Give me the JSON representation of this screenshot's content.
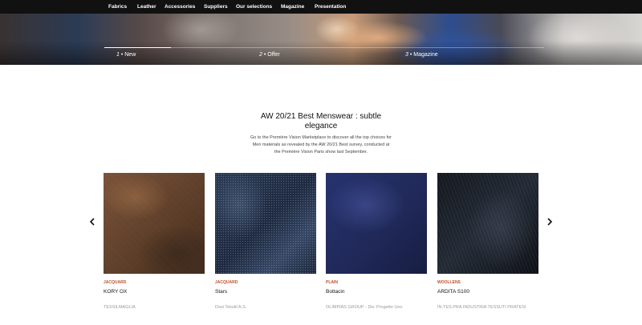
{
  "nav": {
    "items": [
      "Fabrics",
      "Leather",
      "Accessories",
      "Suppliers",
      "Our selections",
      "Magazine",
      "Presentation"
    ]
  },
  "hero": {
    "tabs": [
      {
        "num": "1",
        "label": "New"
      },
      {
        "num": "2",
        "label": "Offer"
      },
      {
        "num": "3",
        "label": "Magazine"
      }
    ]
  },
  "section": {
    "title": "AW 20/21 Best Menswear : subtle elegance",
    "intro": "Go to the Première Vision Marketplace to discover all the top choices for Men materials as revealed by the AW 20/21 Best survey, conducted at the Première Vision Paris show last September."
  },
  "carousel": {
    "prev_icon": "chevron-left-icon",
    "next_icon": "chevron-right-icon",
    "category_color": "#c0502a",
    "products": [
      {
        "category": "JACQUARD",
        "name": "KORY OX",
        "maker": "TESSILMAGLIA"
      },
      {
        "category": "JACQUARD",
        "name": "Stars",
        "maker": "Dosi Tekstil A.S."
      },
      {
        "category": "PLAIN",
        "name": "Bottacin",
        "maker": "OLIMPIAS GROUP - Div. Progetto Uno"
      },
      {
        "category": "WOOLLENS",
        "name": "ARDITA S100",
        "maker": "IN.TES.PRA INDUSTRIA TESSUTI PRATESI"
      }
    ]
  }
}
